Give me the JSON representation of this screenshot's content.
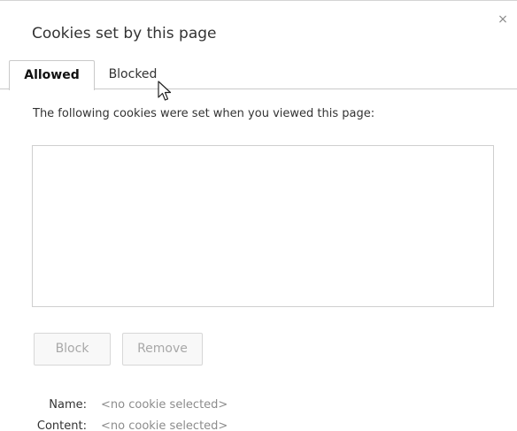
{
  "dialog": {
    "title": "Cookies set by this page",
    "close_label": "×"
  },
  "tabs": [
    {
      "label": "Allowed",
      "selected": true
    },
    {
      "label": "Blocked",
      "selected": false
    }
  ],
  "description": "The following cookies were set when you viewed this page:",
  "buttons": {
    "block_label": "Block",
    "remove_label": "Remove"
  },
  "details": [
    {
      "label": "Name:",
      "value": "<no cookie selected>"
    },
    {
      "label": "Content:",
      "value": "<no cookie selected>"
    }
  ],
  "colors": {
    "tab_border": "#c9c9c9",
    "disabled_text": "#a8a8a8",
    "value_text": "#8c8c8c"
  },
  "icons": {
    "close": "close-icon",
    "cursor": "mouse-pointer-icon"
  }
}
